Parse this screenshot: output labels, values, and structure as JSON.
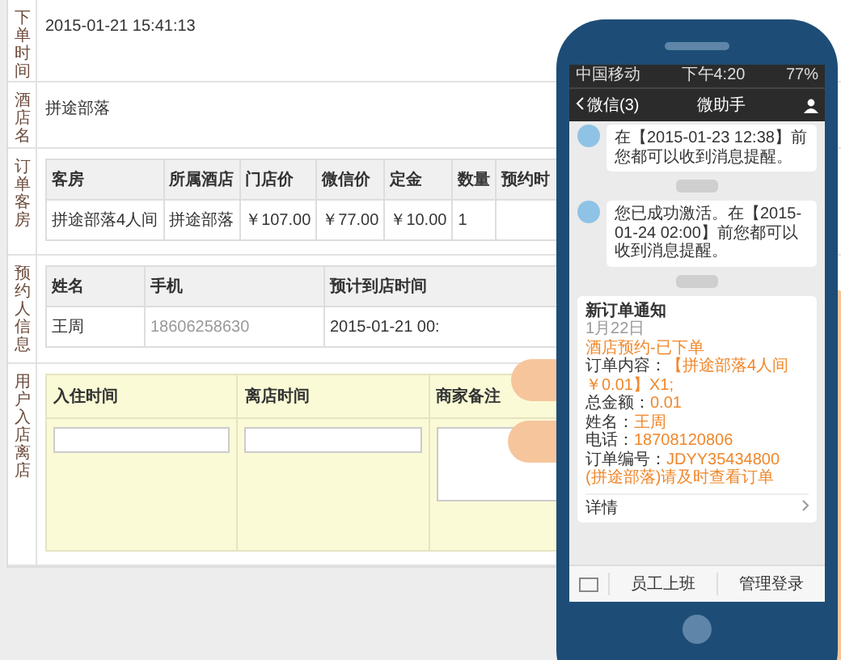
{
  "order_form": {
    "sections": [
      {
        "label": "下单时间",
        "kind": "text",
        "value": "2015-01-21 15:41:13"
      },
      {
        "label": "酒店名",
        "kind": "text",
        "value": "拼途部落"
      },
      {
        "label": "订单客房",
        "kind": "table",
        "columns": [
          "客房",
          "所属酒店",
          "门店价",
          "微信价",
          "定金",
          "数量",
          "预约时"
        ],
        "rows": [
          [
            "拼途部落4人间",
            "拼途部落",
            "￥107.00",
            "￥77.00",
            "￥10.00",
            "1",
            ""
          ]
        ]
      },
      {
        "label": "预约人信息",
        "kind": "table",
        "columns": [
          "姓名",
          "手机",
          "预计到店时间"
        ],
        "rows": [
          [
            "王周",
            "18606258630",
            "2015-01-21 00:"
          ]
        ]
      },
      {
        "label": "用户入店离店",
        "kind": "inputs",
        "fields": [
          {
            "label": "入住时间",
            "kind": "input"
          },
          {
            "label": "离店时间",
            "kind": "input"
          },
          {
            "label": "商家备注",
            "kind": "textarea"
          }
        ]
      }
    ]
  },
  "phone": {
    "status_bar": {
      "carrier": "中国移动",
      "time": "下午4:20",
      "battery": "77%"
    },
    "nav": {
      "back": "微信(3)",
      "title": "微助手"
    },
    "messages": [
      {
        "kind": "text",
        "text": "在【2015-01-23 12:38】前您都可以收到消息提醒。"
      },
      {
        "kind": "timestamp"
      },
      {
        "kind": "text",
        "text": "您已成功激活。在【2015-01-24 02:00】前您都可以收到消息提醒。"
      },
      {
        "kind": "timestamp"
      },
      {
        "kind": "card",
        "title": "新订单通知",
        "date": "1月22日",
        "lines": [
          {
            "value": "酒店预约-已下单"
          },
          {
            "label": "订单内容：",
            "value": "【拼途部落4人间￥0.01】X1;"
          },
          {
            "label": "总金额：",
            "value": "0.01"
          },
          {
            "label": "姓名：",
            "value": "王周"
          },
          {
            "label": "电话：",
            "value": "18708120806"
          },
          {
            "label": "订单编号：",
            "value": "JDYY35434800"
          },
          {
            "value": "(拼途部落)请及时查看订单"
          }
        ],
        "link": "详情"
      }
    ],
    "bottom_bar": [
      "员工上班",
      "管理登录"
    ]
  }
}
